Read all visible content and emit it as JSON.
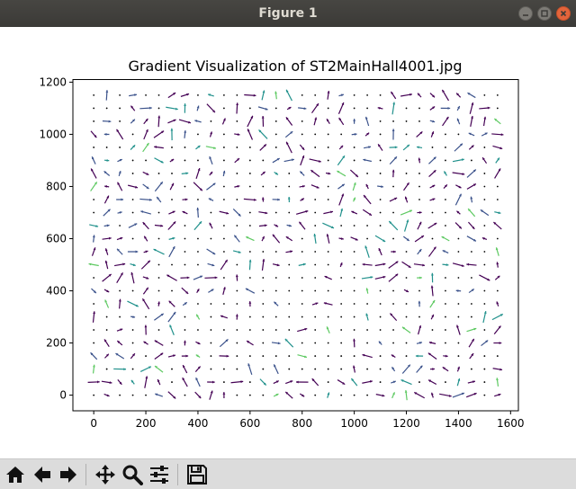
{
  "window": {
    "title": "Figure 1"
  },
  "toolbar": {
    "buttons": [
      {
        "name": "home-button",
        "icon": "home-icon"
      },
      {
        "name": "back-button",
        "icon": "arrow-left-icon"
      },
      {
        "name": "forward-button",
        "icon": "arrow-right-icon"
      },
      {
        "name": "pan-button",
        "icon": "move-icon"
      },
      {
        "name": "zoom-button",
        "icon": "magnifier-icon"
      },
      {
        "name": "configure-subplots-button",
        "icon": "sliders-icon"
      },
      {
        "name": "save-button",
        "icon": "floppy-disk-icon"
      }
    ]
  },
  "chart_data": {
    "type": "quiver",
    "title": "Gradient Visualization of ST2MainHall4001.jpg",
    "xlabel": "",
    "ylabel": "",
    "xlim": [
      -80,
      1630
    ],
    "ylim": [
      -60,
      1210
    ],
    "xticks": [
      0,
      200,
      400,
      600,
      800,
      1000,
      1200,
      1400,
      1600
    ],
    "yticks": [
      0,
      200,
      400,
      600,
      800,
      1000,
      1200
    ],
    "grid_x": {
      "start": 0,
      "step": 50,
      "count": 32
    },
    "grid_y": {
      "start": 0,
      "step": 50,
      "count": 24
    },
    "colormap": [
      "#440154",
      "#3b528b",
      "#21918c",
      "#5ec962"
    ],
    "grid": false,
    "legend": "none"
  }
}
